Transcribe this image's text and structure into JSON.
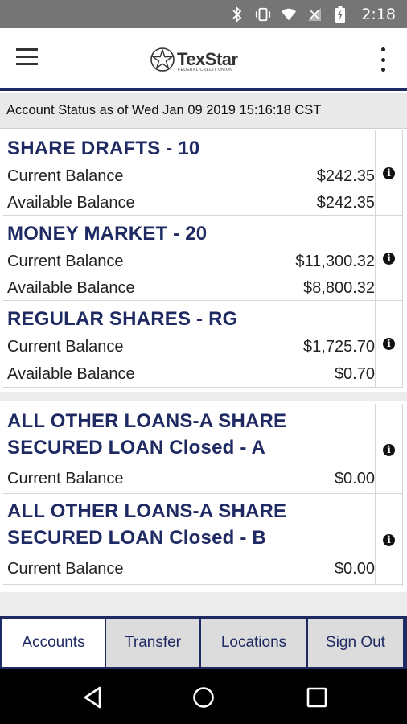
{
  "status_bar": {
    "time": "2:18",
    "icons": [
      "bluetooth-icon",
      "vibrate-icon",
      "wifi-icon",
      "signal-icon",
      "battery-charging-icon"
    ]
  },
  "header": {
    "logo_text": "TexStar",
    "logo_subtext": "FEDERAL CREDIT UNION",
    "menu_icon": "hamburger-menu-icon",
    "overflow_icon": "more-vert-icon"
  },
  "account_status": "Account Status as of Wed Jan 09 2019 15:16:18 CST",
  "share_accounts": [
    {
      "name": "SHARE DRAFTS - 10",
      "lines": [
        {
          "label": "Current Balance",
          "value": "$242.35"
        },
        {
          "label": "Available Balance",
          "value": "$242.35"
        }
      ]
    },
    {
      "name": "MONEY MARKET - 20",
      "lines": [
        {
          "label": "Current Balance",
          "value": "$11,300.32"
        },
        {
          "label": "Available Balance",
          "value": "$8,800.32"
        }
      ]
    },
    {
      "name": "REGULAR SHARES - RG",
      "lines": [
        {
          "label": "Current Balance",
          "value": "$1,725.70"
        },
        {
          "label": "Available Balance",
          "value": "$0.70"
        }
      ]
    }
  ],
  "loan_accounts": [
    {
      "name_line1": "ALL OTHER LOANS-A SHARE",
      "name_line2": "SECURED LOAN Closed - A",
      "lines": [
        {
          "label": "Current Balance",
          "value": "$0.00"
        }
      ]
    },
    {
      "name_line1": "ALL OTHER LOANS-A SHARE",
      "name_line2": "SECURED LOAN Closed - B",
      "lines": [
        {
          "label": "Current Balance",
          "value": "$0.00"
        }
      ]
    }
  ],
  "tabs": [
    {
      "label": "Accounts",
      "active": true
    },
    {
      "label": "Transfer",
      "active": false
    },
    {
      "label": "Locations",
      "active": false
    },
    {
      "label": "Sign Out",
      "active": false
    }
  ],
  "info_glyph": "i",
  "colors": {
    "brand_navy": "#1f2a63",
    "status_bar": "#757575",
    "tab_inactive": "#dcdcdc"
  }
}
